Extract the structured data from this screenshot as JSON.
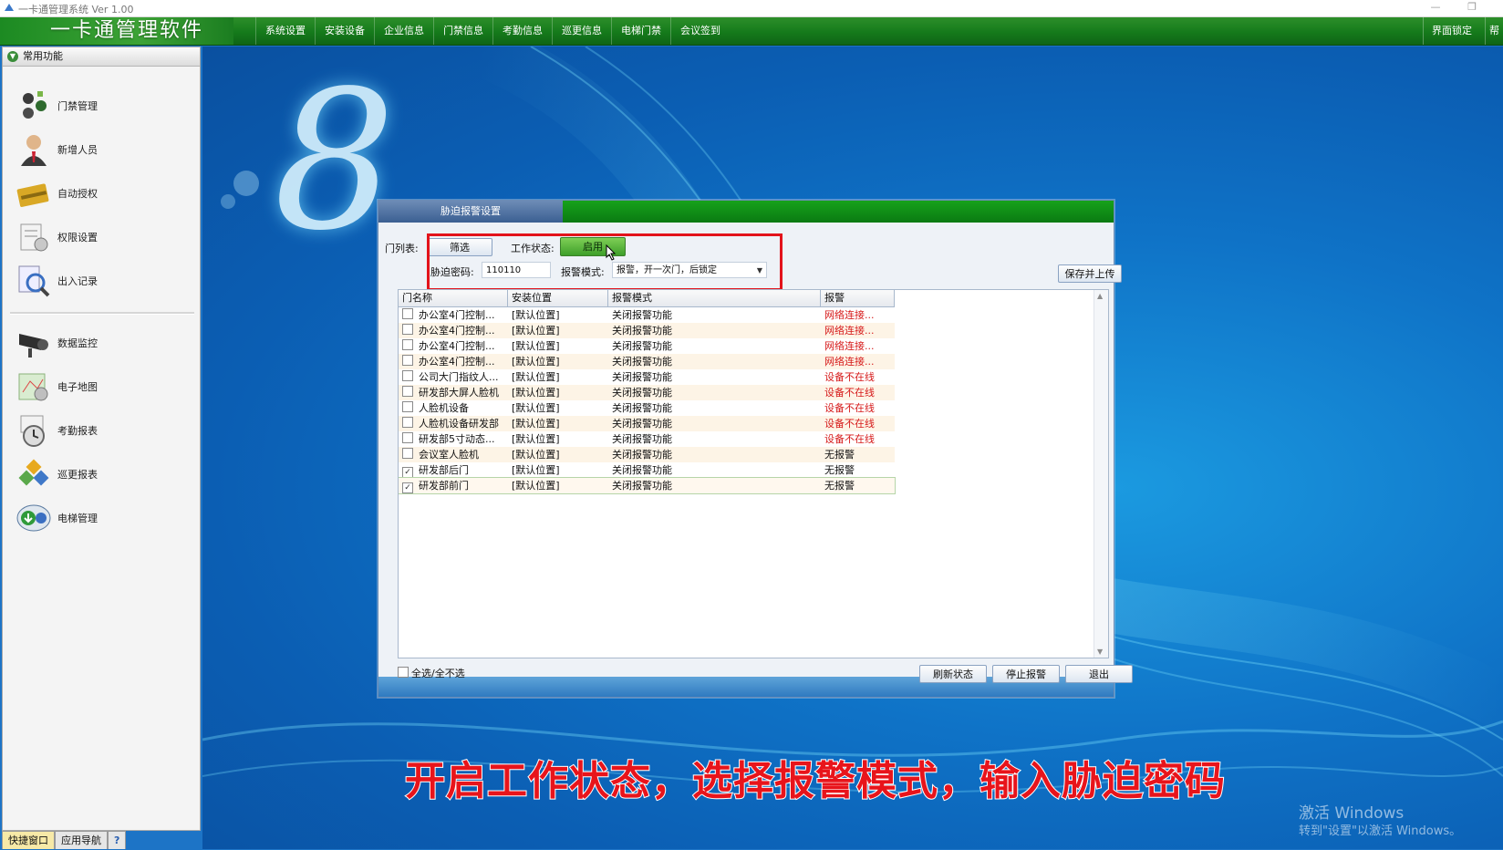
{
  "window": {
    "title": "一卡通管理系统  Ver 1.00",
    "minimize_glyph": "—",
    "restore_glyph": "❐"
  },
  "brand": "一卡通管理软件",
  "menu": [
    "系统设置",
    "安装设备",
    "企业信息",
    "门禁信息",
    "考勤信息",
    "巡更信息",
    "电梯门禁",
    "会议签到"
  ],
  "menu_right": [
    "界面锁定",
    "帮"
  ],
  "sidebar": {
    "header": "常用功能",
    "items": [
      {
        "label": "门禁管理",
        "icon": "door-access-icon"
      },
      {
        "label": "新增人员",
        "icon": "person-icon"
      },
      {
        "label": "自动授权",
        "icon": "card-icon"
      },
      {
        "label": "权限设置",
        "icon": "permission-icon"
      },
      {
        "label": "出入记录",
        "icon": "record-search-icon"
      },
      {
        "label": "数据监控",
        "icon": "camera-icon"
      },
      {
        "label": "电子地图",
        "icon": "map-icon"
      },
      {
        "label": "考勤报表",
        "icon": "clock-icon"
      },
      {
        "label": "巡更报表",
        "icon": "patrol-icon"
      },
      {
        "label": "电梯管理",
        "icon": "elevator-icon"
      }
    ],
    "bottom_tabs": [
      "快捷窗口",
      "应用导航",
      "?"
    ]
  },
  "dialog": {
    "tab": "胁迫报警设置",
    "door_list_label": "门列表:",
    "filter_button": "筛选",
    "work_status_label": "工作状态:",
    "work_status_value": "启用",
    "duress_password_label": "胁迫密码:",
    "duress_password_value": "110110",
    "alarm_mode_label": "报警模式:",
    "alarm_mode_value": "报警，开一次门，后锁定",
    "save_button": "保存并上传",
    "columns": [
      "门名称",
      "安装位置",
      "报警模式",
      "报警"
    ],
    "rows": [
      {
        "name": "办公室4门控制...",
        "location": "[默认位置]",
        "mode": "关闭报警功能",
        "alarm": "网络连接...",
        "checked": false,
        "red": true
      },
      {
        "name": "办公室4门控制...",
        "location": "[默认位置]",
        "mode": "关闭报警功能",
        "alarm": "网络连接...",
        "checked": false,
        "red": true
      },
      {
        "name": "办公室4门控制...",
        "location": "[默认位置]",
        "mode": "关闭报警功能",
        "alarm": "网络连接...",
        "checked": false,
        "red": true
      },
      {
        "name": "办公室4门控制...",
        "location": "[默认位置]",
        "mode": "关闭报警功能",
        "alarm": "网络连接...",
        "checked": false,
        "red": true
      },
      {
        "name": "公司大门指纹人...",
        "location": "[默认位置]",
        "mode": "关闭报警功能",
        "alarm": "设备不在线",
        "checked": false,
        "red": true
      },
      {
        "name": "研发部大屏人脸机",
        "location": "[默认位置]",
        "mode": "关闭报警功能",
        "alarm": "设备不在线",
        "checked": false,
        "red": true
      },
      {
        "name": "人脸机设备",
        "location": "[默认位置]",
        "mode": "关闭报警功能",
        "alarm": "设备不在线",
        "checked": false,
        "red": true
      },
      {
        "name": "人脸机设备研发部",
        "location": "[默认位置]",
        "mode": "关闭报警功能",
        "alarm": "设备不在线",
        "checked": false,
        "red": true
      },
      {
        "name": "研发部5寸动态...",
        "location": "[默认位置]",
        "mode": "关闭报警功能",
        "alarm": "设备不在线",
        "checked": false,
        "red": true
      },
      {
        "name": "会议室人脸机",
        "location": "[默认位置]",
        "mode": "关闭报警功能",
        "alarm": "无报警",
        "checked": false,
        "red": false
      },
      {
        "name": "研发部后门",
        "location": "[默认位置]",
        "mode": "关闭报警功能",
        "alarm": "无报警",
        "checked": true,
        "red": false
      },
      {
        "name": "研发部前门",
        "location": "[默认位置]",
        "mode": "关闭报警功能",
        "alarm": "无报警",
        "checked": true,
        "red": false
      }
    ],
    "select_all_label": "全选/全不选",
    "refresh_button": "刷新状态",
    "stop_alarm_button": "停止报警",
    "exit_button": "退出"
  },
  "caption": "开启工作状态，选择报警模式，输入胁迫密码",
  "watermark": {
    "line1": "激活 Windows",
    "line2": "转到\"设置\"以激活 Windows。"
  },
  "logo_glyph": "8",
  "colors": {
    "menu_green": "#157a1b",
    "dialog_green": "#0a7a12",
    "alert_red": "#d61a1a",
    "caption_red": "#e8141b"
  }
}
